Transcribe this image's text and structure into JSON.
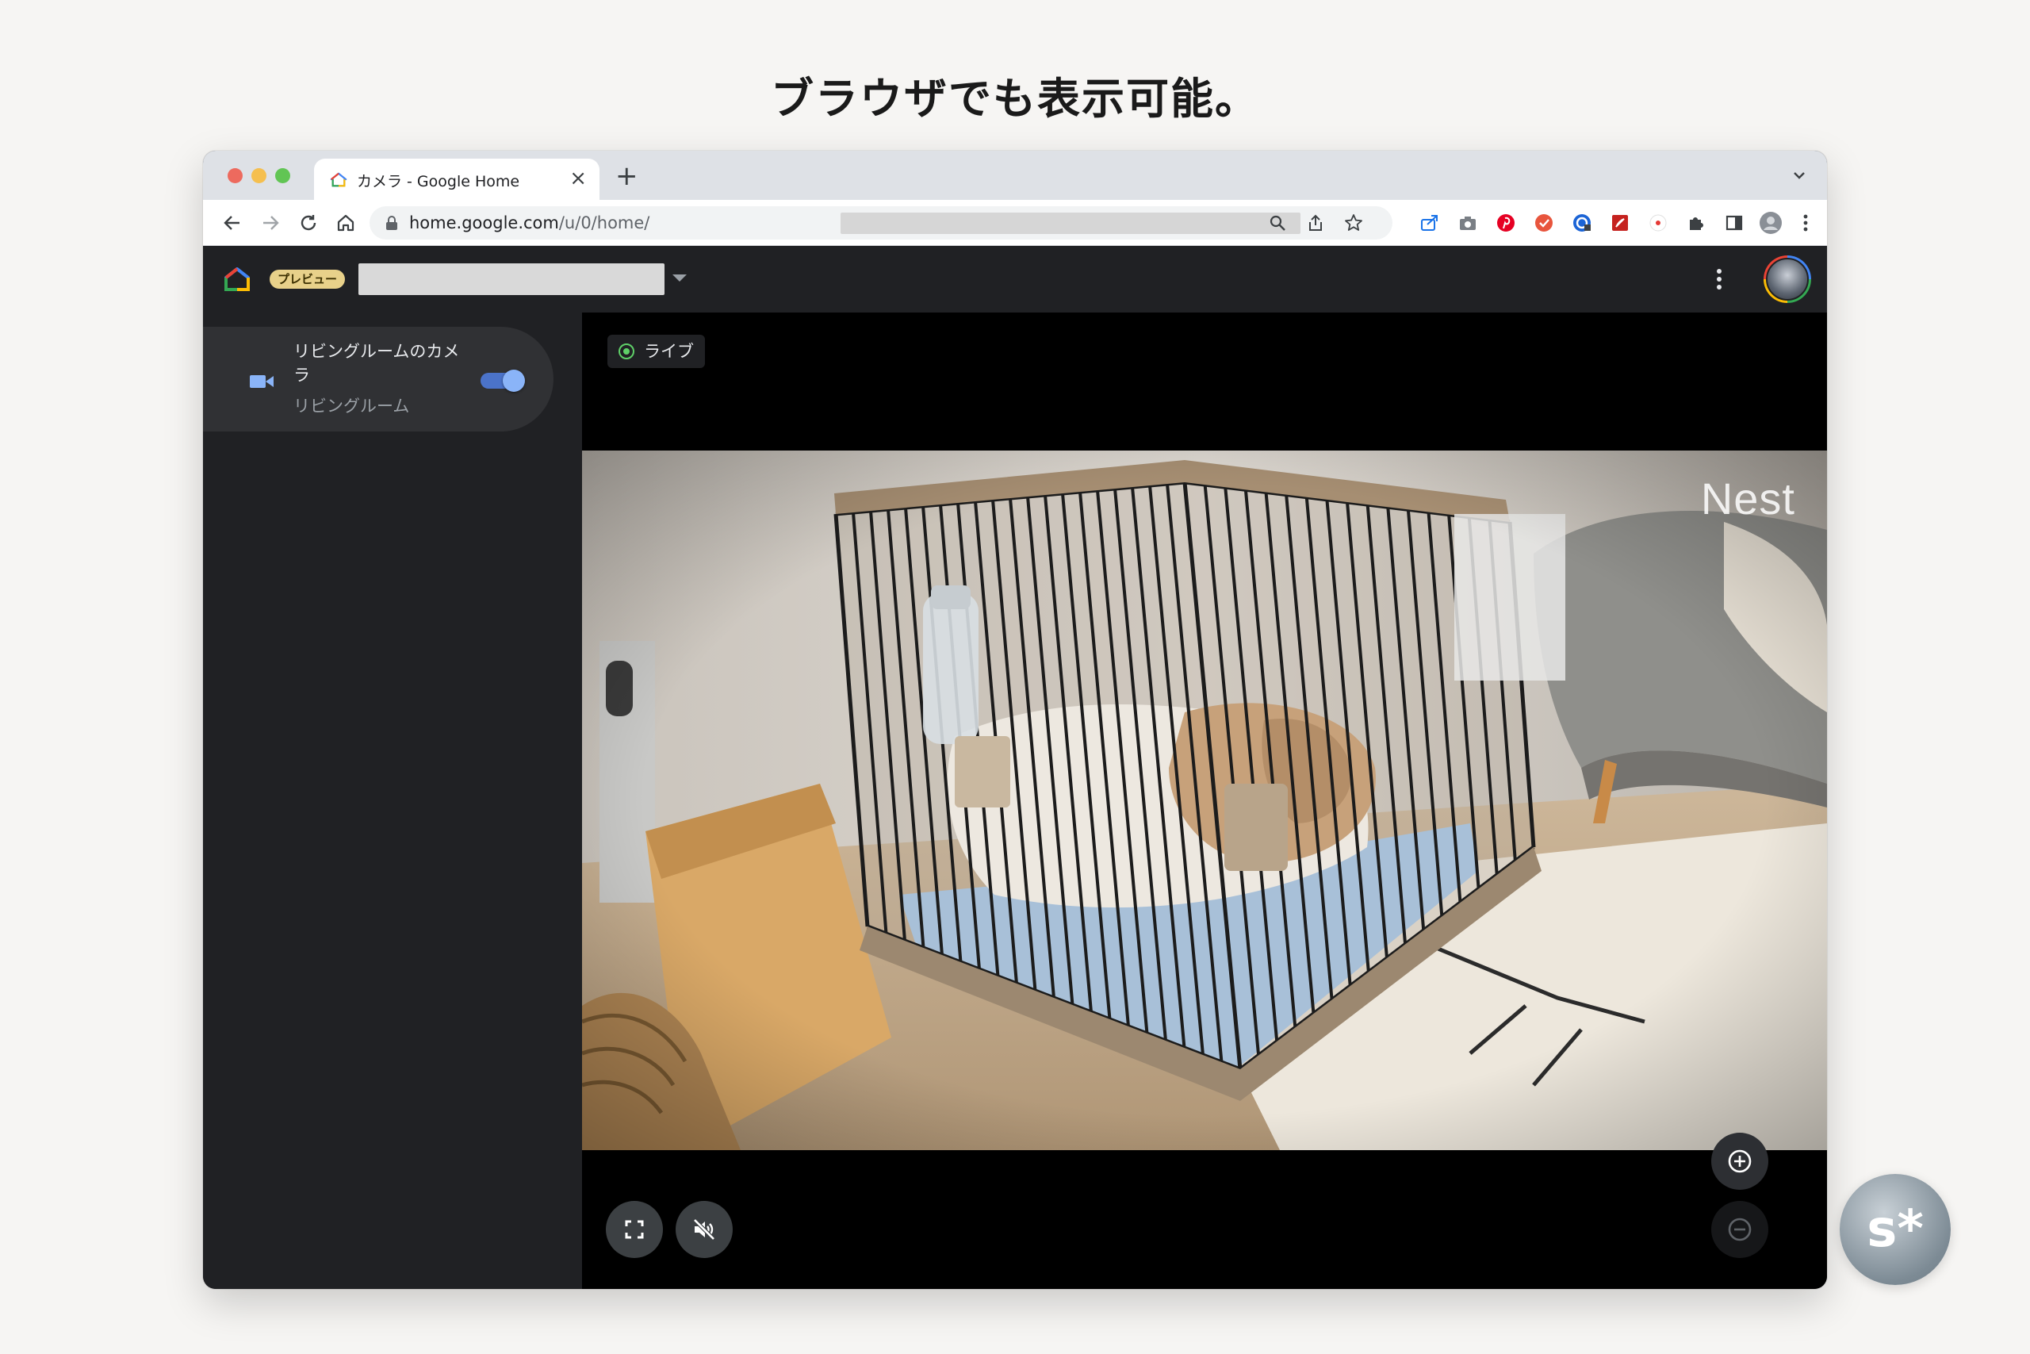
{
  "caption": "ブラウザでも表示可能。",
  "browser": {
    "tab_title": "カメラ - Google Home",
    "tab_close": "×",
    "new_tab": "+",
    "url_host": "home.google.com",
    "url_path": "/u/0/home/"
  },
  "app": {
    "preview_badge": "プレビュー"
  },
  "sidebar": {
    "device_name": "リビングルームのカメラ",
    "device_room": "リビングルーム",
    "device_enabled": true
  },
  "viewer": {
    "live_label": "ライブ",
    "watermark": "Nest"
  },
  "brand_badge": "s*",
  "colors": {
    "live": "#5fd068",
    "accent": "#8ab4f8",
    "app_bg": "#202124"
  }
}
